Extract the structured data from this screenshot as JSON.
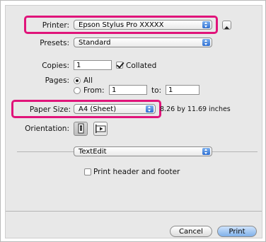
{
  "printer": {
    "label": "Printer:",
    "value": "Epson Stylus Pro XXXXX"
  },
  "presets": {
    "label": "Presets:",
    "value": "Standard"
  },
  "copies": {
    "label": "Copies:",
    "value": "1",
    "collated_label": "Collated",
    "collated": true
  },
  "pages": {
    "label": "Pages:",
    "all_label": "All",
    "from_label": "From:",
    "from_value": "1",
    "to_label": "to:",
    "to_value": "1",
    "selected": "All"
  },
  "paper_size": {
    "label": "Paper Size:",
    "value": "A4 (Sheet)",
    "dimensions": "8.26 by 11.69 inches"
  },
  "orientation": {
    "label": "Orientation:"
  },
  "app_menu": {
    "value": "TextEdit"
  },
  "header_footer": {
    "label": "Print header and footer",
    "checked": false
  },
  "buttons": {
    "cancel": "Cancel",
    "print": "Print"
  },
  "colors": {
    "highlight": "#e0147a",
    "accent": "#2f6fd1"
  }
}
